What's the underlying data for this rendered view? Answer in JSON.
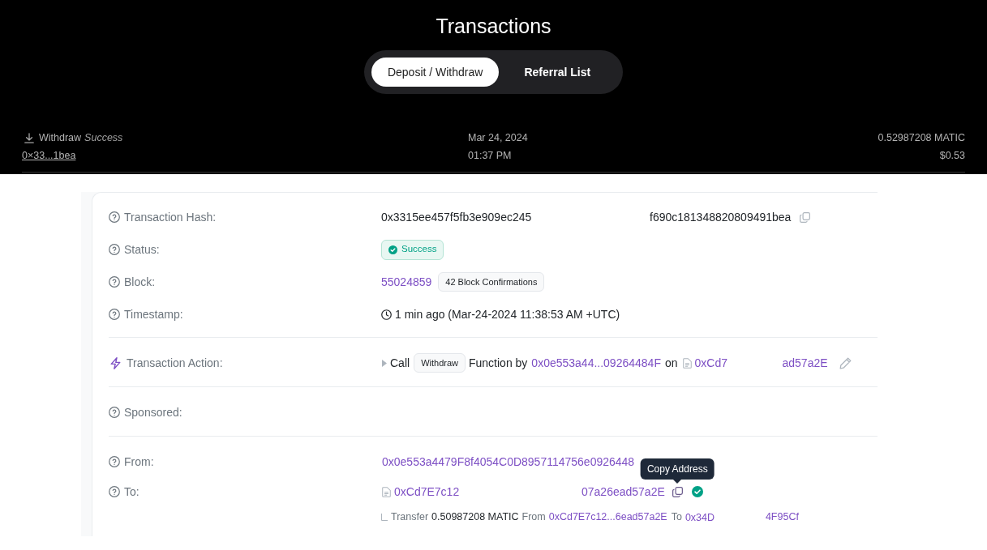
{
  "header": {
    "title": "Transactions",
    "tabs": [
      {
        "label": "Deposit / Withdraw",
        "selected": true
      },
      {
        "label": "Referral List",
        "selected": false
      }
    ]
  },
  "transactions": [
    {
      "type": "Withdraw",
      "status": "Success",
      "hash": "0×33...1bea",
      "date": "Mar 24, 2024",
      "time": "01:37 PM",
      "amount": "0.52987208 MATIC",
      "value": "$0.53"
    }
  ],
  "details": {
    "sections": [
      {
        "rows": [
          {
            "kind": "hash",
            "label": "Transaction Hash:",
            "value_start": "0x3315ee457f5fb3e909ec245",
            "value_end": "f690c181348820809491bea"
          },
          {
            "kind": "status",
            "label": "Status:",
            "status": "Success"
          },
          {
            "kind": "block",
            "label": "Block:",
            "block": "55024859",
            "confirmations": "42 Block Confirmations"
          },
          {
            "kind": "timestamp",
            "label": "Timestamp:",
            "value": "1 min ago (Mar-24-2024 11:38:53 AM +UTC)"
          }
        ]
      },
      {
        "rows": [
          {
            "kind": "action",
            "label": "Transaction Action:",
            "call": "Call",
            "method": "Withdraw",
            "by": "Function by",
            "caller": "0x0e553a44...09264484F",
            "on": "on",
            "contract_start": "0xCd7",
            "contract_end": "ad57a2E"
          }
        ]
      },
      {
        "rows": [
          {
            "kind": "plain",
            "label": "Sponsored:"
          }
        ]
      },
      {
        "rows": [
          {
            "kind": "address",
            "label": "From:",
            "address": "0x0e553a4479F8f4054C0D8957114756e0926448"
          },
          {
            "kind": "contract",
            "label": "To:",
            "address_start": "0xCd7E7c12",
            "address_end": "07a26ead57a2E",
            "tooltip": "Copy Address",
            "verified": true
          },
          {
            "kind": "transfer",
            "transfer": "Transfer",
            "amount": "0.50987208 MATIC",
            "from_label": "From",
            "from": "0xCd7E7c12...6ead57a2E",
            "to_label": "To",
            "to_start": "0x34D",
            "to_end": "4F95Cf"
          }
        ]
      }
    ]
  }
}
